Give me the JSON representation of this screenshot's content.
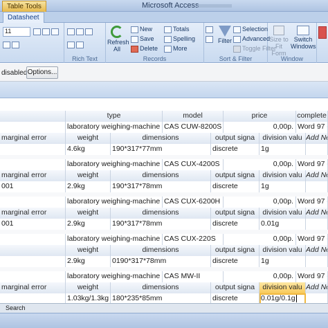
{
  "titlebar": {
    "context_tab": "Table Tools",
    "app_title": "Microsoft Access"
  },
  "tabs": {
    "datasheet": "Datasheet"
  },
  "ribbon": {
    "font_size": "11",
    "groups": {
      "rich_text": "Rich Text",
      "records": "Records",
      "sort_filter": "Sort & Filter",
      "window": "Window"
    },
    "refresh": "Refresh All",
    "new": "New",
    "save": "Save",
    "delete": "Delete",
    "totals": "Totals",
    "spelling": "Spelling",
    "more": "More",
    "filter": "Filter",
    "selection": "Selection",
    "advanced": "Advanced",
    "toggle_filter": "Toggle Filter",
    "size_to_fit": "Size to Fit Form",
    "switch_windows": "Switch Windows"
  },
  "message_bar": {
    "text": "disabled",
    "options_label": "Options..."
  },
  "main_header": {
    "type": "type",
    "model": "model",
    "price": "price",
    "complete": "complete"
  },
  "sub_header": {
    "marginal_error": "marginal error",
    "weight": "weight",
    "dimensions": "dimensions",
    "output_signal": "output signa",
    "division_value": "division valu",
    "add_new": "Add Ne"
  },
  "records": [
    {
      "type": "laboratory weighing-machine",
      "model": "CAS CUW-8200S",
      "price": "0,00р.",
      "complete": "Word 97 -",
      "marginal_error": "",
      "weight": "4.6kg",
      "dimensions": "190*317*77mm",
      "output_signal": "discrete",
      "division_value": "1g"
    },
    {
      "type": "laboratory weighing-machine",
      "model": "CAS CUX-4200S",
      "price": "0,00р.",
      "complete": "Word 97 -",
      "marginal_error": "001",
      "weight": "2.9kg",
      "dimensions": "190*317*78mm",
      "output_signal": "discrete",
      "division_value": "1g"
    },
    {
      "type": "laboratory weighing-machine",
      "model": "CAS CUX-6200H",
      "price": "0,00р.",
      "complete": "Word 97 -",
      "marginal_error": "001",
      "weight": "2.9kg",
      "dimensions": "190*317*78mm",
      "output_signal": "discrete",
      "division_value": "0.01g"
    },
    {
      "type": "laboratory weighing-machine",
      "model": "CAS CUX-220S",
      "price": "0,00р.",
      "complete": "Word 97 -",
      "marginal_error": "",
      "weight": "2.9kg",
      "dimensions": "0190*317*78mm",
      "output_signal": "discrete",
      "division_value": "1g"
    },
    {
      "type": "laboratory weighing-machine",
      "model": "CAS MW-II",
      "price": "0,00р.",
      "complete": "Word 97 -",
      "marginal_error": "",
      "weight": "1.03kg/1.3kg",
      "dimensions": "180*235*85mm",
      "output_signal": "discrete",
      "division_value": "0.01g/0.1g"
    }
  ],
  "footer": {
    "search": "Search"
  }
}
